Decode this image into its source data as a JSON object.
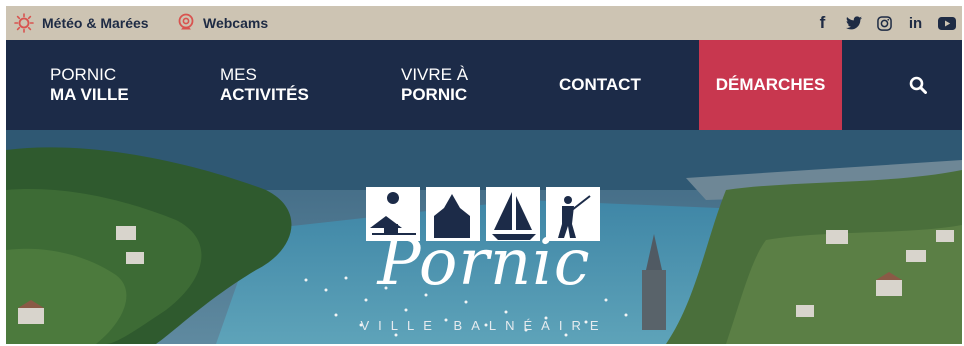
{
  "topbar": {
    "meteo_label": "Météo & Marées",
    "webcam_label": "Webcams",
    "social": [
      {
        "icon": "facebook-icon",
        "glyph": "f"
      },
      {
        "icon": "twitter-icon",
        "glyph": ""
      },
      {
        "icon": "instagram-icon",
        "glyph": ""
      },
      {
        "icon": "linkedin-icon",
        "glyph": "in"
      },
      {
        "icon": "youtube-icon",
        "glyph": ""
      }
    ]
  },
  "nav": {
    "items": [
      {
        "line1": "PORNIC",
        "line2": "MA VILLE"
      },
      {
        "line1": "MES",
        "line2": "ACTIVITÉS"
      },
      {
        "line1": "VIVRE À",
        "line2": "PORNIC"
      },
      {
        "line1": "CONTACT",
        "line2": ""
      }
    ],
    "highlight": "DÉMARCHES"
  },
  "hero": {
    "brand_name": "Pornic",
    "tagline": "VILLE BALNÉAIRE"
  },
  "colors": {
    "topbar": "#cdc4b3",
    "nav": "#1c2b48",
    "highlight": "#c8374f",
    "sun_icon": "#d9534f"
  }
}
